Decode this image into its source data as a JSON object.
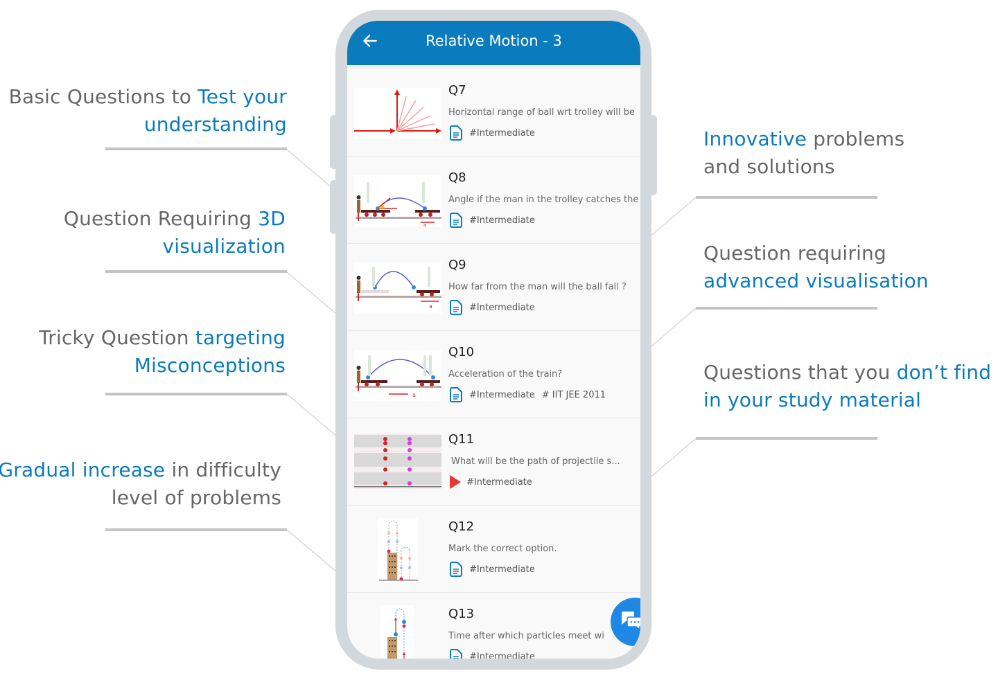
{
  "colors": {
    "accent": "#0a7bbd",
    "text_gray": "#666666",
    "phone_frame": "#d3d8dd",
    "fab": "#1e88e5",
    "play": "#e53935"
  },
  "callouts": {
    "left": [
      {
        "plain_before": "Basic Questions to ",
        "highlight": "Test your understanding",
        "plain_after": ""
      },
      {
        "plain_before": "Question Requiring ",
        "highlight": "3D visualization",
        "plain_after": ""
      },
      {
        "plain_before": "Tricky Question ",
        "highlight": "targeting Misconceptions",
        "plain_after": ""
      },
      {
        "plain_before": "",
        "highlight": "Gradual increase",
        "plain_after": " in difficulty level of problems"
      }
    ],
    "right": [
      {
        "plain_before": "",
        "highlight": "Innovative",
        "plain_after": " problems and solutions"
      },
      {
        "plain_before": "Question requiring ",
        "highlight": "advanced visualisation",
        "plain_after": ""
      },
      {
        "plain_before": "Questions that you ",
        "highlight": "don’t find in your study material",
        "plain_after": ""
      }
    ]
  },
  "app": {
    "title": "Relative Motion - 3",
    "back_icon": "arrow-left-icon",
    "fab_icon": "chat-bubbles-icon",
    "questions": [
      {
        "number": "Q7",
        "text": "Horizontal range of ball wrt trolley will be",
        "media": "document",
        "tags": [
          "#Intermediate"
        ],
        "thumb": "vectors"
      },
      {
        "number": "Q8",
        "text": "Angle if the man in the trolley catches the",
        "media": "document",
        "tags": [
          "#Intermediate"
        ],
        "thumb": "trolley-angle"
      },
      {
        "number": "Q9",
        "text": "How far from the man will the ball fall ?",
        "media": "document",
        "tags": [
          "#Intermediate"
        ],
        "thumb": "trolley-fall"
      },
      {
        "number": "Q10",
        "text": "Acceleration of the train?",
        "media": "document",
        "tags": [
          "#Intermediate",
          "# IIT JEE 2011"
        ],
        "thumb": "train"
      },
      {
        "number": "Q11",
        "text": "What will be the path of projectile s...",
        "media": "video",
        "tags": [
          "#Intermediate"
        ],
        "thumb": "strobe"
      },
      {
        "number": "Q12",
        "text": "Mark the correct option.",
        "media": "document",
        "tags": [
          "#Intermediate"
        ],
        "thumb": "building-two"
      },
      {
        "number": "Q13",
        "text": "Time after which particles meet wi",
        "media": "document",
        "tags": [
          "#Intermediate"
        ],
        "thumb": "building-one"
      }
    ]
  }
}
